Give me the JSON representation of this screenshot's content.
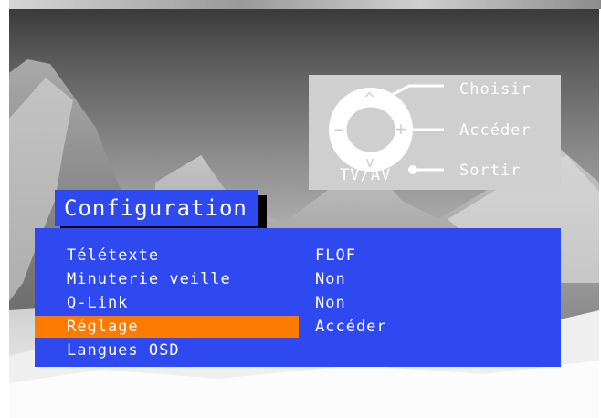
{
  "remote_legend": {
    "choose": "Choisir",
    "enter": "Accéder",
    "exit": "Sortir",
    "tvav": "TV/AV",
    "up_symbol": "^",
    "down_symbol": "v",
    "left_symbol": "−",
    "right_symbol": "+"
  },
  "menu": {
    "title": "Configuration",
    "items": [
      {
        "label": "Télétexte",
        "value": "FLOF"
      },
      {
        "label": "Minuterie veille",
        "value": "Non"
      },
      {
        "label": "Q-Link",
        "value": "Non"
      },
      {
        "label": "Réglage",
        "value": "Accéder",
        "selected": true
      },
      {
        "label": "Langues OSD",
        "value": ""
      }
    ]
  },
  "colors": {
    "menu_blue": "#2f49f0",
    "highlight_orange": "#ff7a00",
    "legend_grey": "#cfcfcf"
  }
}
